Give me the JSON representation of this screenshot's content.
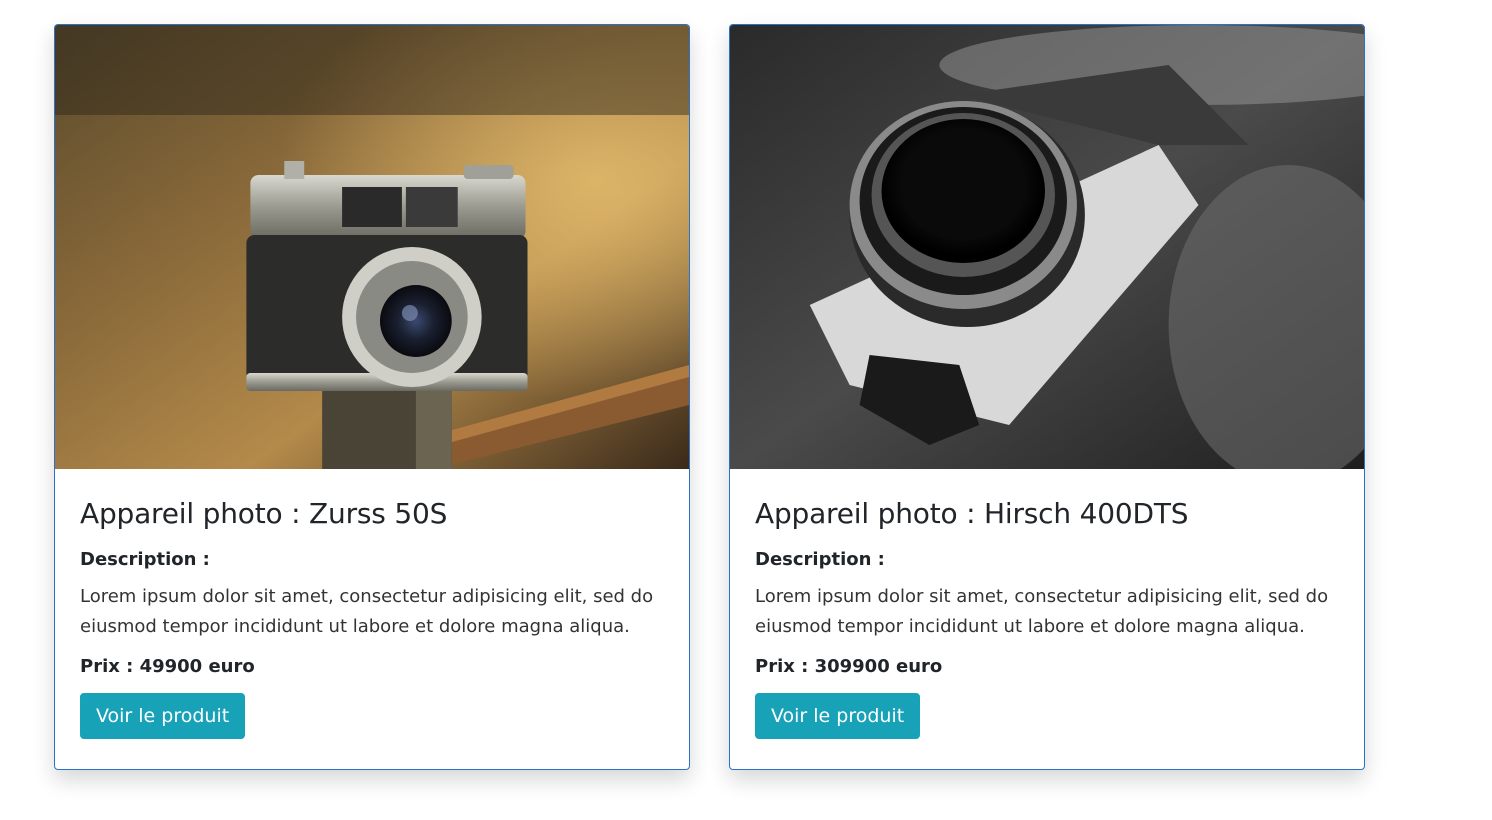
{
  "products": [
    {
      "title": "Appareil photo : Zurss 50S",
      "description_label": "Description :",
      "description": "Lorem ipsum dolor sit amet, consectetur adipisicing elit, sed do eiusmod tempor incididunt ut labore et dolore magna aliqua.",
      "price": "Prix : 49900 euro",
      "button_label": "Voir le produit"
    },
    {
      "title": "Appareil photo : Hirsch 400DTS",
      "description_label": "Description :",
      "description": "Lorem ipsum dolor sit amet, consectetur adipisicing elit, sed do eiusmod tempor incididunt ut labore et dolore magna aliqua.",
      "price": "Prix : 309900 euro",
      "button_label": "Voir le produit"
    }
  ],
  "colors": {
    "card_border": "#2a72c9",
    "button_bg": "#17a2b8",
    "text": "#212529"
  }
}
